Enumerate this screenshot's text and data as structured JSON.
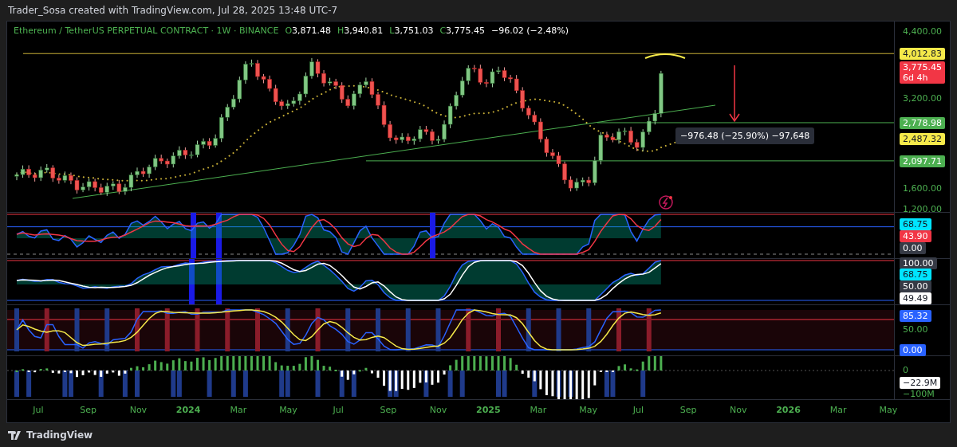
{
  "header": {
    "attribution": "Trader_Sosa created with TradingView.com, Jul 28, 2025 13:48 UTC-7"
  },
  "legend": {
    "symbol": "Ethereum / TetherUS PERPETUAL CONTRACT · 1W · BINANCE",
    "ohlc": [
      {
        "letter": "O",
        "value": "3,871.48"
      },
      {
        "letter": "H",
        "value": "3,940.81"
      },
      {
        "letter": "L",
        "value": "3,751.03"
      },
      {
        "letter": "C",
        "value": "3,775.45"
      }
    ],
    "change": "−96.02 (−2.48%)"
  },
  "measure_tooltip": "−976.48 (−25.90%) −97,648",
  "panes": [
    {
      "axis": [
        {
          "text": "4,400.00",
          "kind": "tick"
        },
        {
          "text": "4,012.83",
          "kind": "badge",
          "color": "#f5e94a"
        },
        {
          "text": "3,775.45",
          "sub": "6d 4h",
          "kind": "badge",
          "color": "#f23645"
        },
        {
          "text": "3,200.00",
          "kind": "tick"
        },
        {
          "text": "2,778.98",
          "kind": "badge",
          "color": "#4caf50"
        },
        {
          "text": "2,487.32",
          "kind": "badge",
          "color": "#f5e94a"
        },
        {
          "text": "2,097.71",
          "kind": "badge",
          "color": "#4caf50"
        },
        {
          "text": "1,600.00",
          "kind": "tick"
        },
        {
          "text": "1,200.00",
          "kind": "tick"
        }
      ]
    },
    {
      "axis": [
        {
          "text": "68.75",
          "kind": "badge",
          "color": "#00e5ff"
        },
        {
          "text": "43.90",
          "kind": "badge",
          "color": "#f23645"
        },
        {
          "text": "0.00",
          "kind": "badge",
          "color": "#363a45"
        }
      ]
    },
    {
      "axis": [
        {
          "text": "100.00",
          "kind": "badge",
          "color": "#363a45"
        },
        {
          "text": "68.75",
          "kind": "badge",
          "color": "#00e5ff"
        },
        {
          "text": "50.00",
          "kind": "badge",
          "color": "#363a45"
        },
        {
          "text": "49.49",
          "kind": "badge",
          "color": "#ffffff"
        }
      ]
    },
    {
      "axis": [
        {
          "text": "85.32",
          "kind": "badge",
          "color": "#2962ff"
        },
        {
          "text": "50.00",
          "kind": "tick"
        },
        {
          "text": "0.00",
          "kind": "badge",
          "color": "#2962ff"
        }
      ]
    },
    {
      "axis": [
        {
          "text": "0",
          "kind": "tick"
        },
        {
          "text": "−22.9M",
          "kind": "badge",
          "color": "#ffffff"
        },
        {
          "text": "−100M",
          "kind": "tick"
        }
      ]
    }
  ],
  "time_axis": [
    {
      "label": "Jul",
      "kind": "month"
    },
    {
      "label": "Sep",
      "kind": "month"
    },
    {
      "label": "Nov",
      "kind": "month"
    },
    {
      "label": "2024",
      "kind": "year"
    },
    {
      "label": "Mar",
      "kind": "month"
    },
    {
      "label": "May",
      "kind": "month"
    },
    {
      "label": "Jul",
      "kind": "month"
    },
    {
      "label": "Sep",
      "kind": "month"
    },
    {
      "label": "Nov",
      "kind": "month"
    },
    {
      "label": "2025",
      "kind": "year"
    },
    {
      "label": "Mar",
      "kind": "month"
    },
    {
      "label": "May",
      "kind": "month"
    },
    {
      "label": "Jul",
      "kind": "month"
    },
    {
      "label": "Sep",
      "kind": "month"
    },
    {
      "label": "Nov",
      "kind": "month"
    },
    {
      "label": "2026",
      "kind": "year"
    },
    {
      "label": "Mar",
      "kind": "month"
    },
    {
      "label": "May",
      "kind": "month"
    }
  ],
  "footer": {
    "logo_text": "TradingView"
  }
}
